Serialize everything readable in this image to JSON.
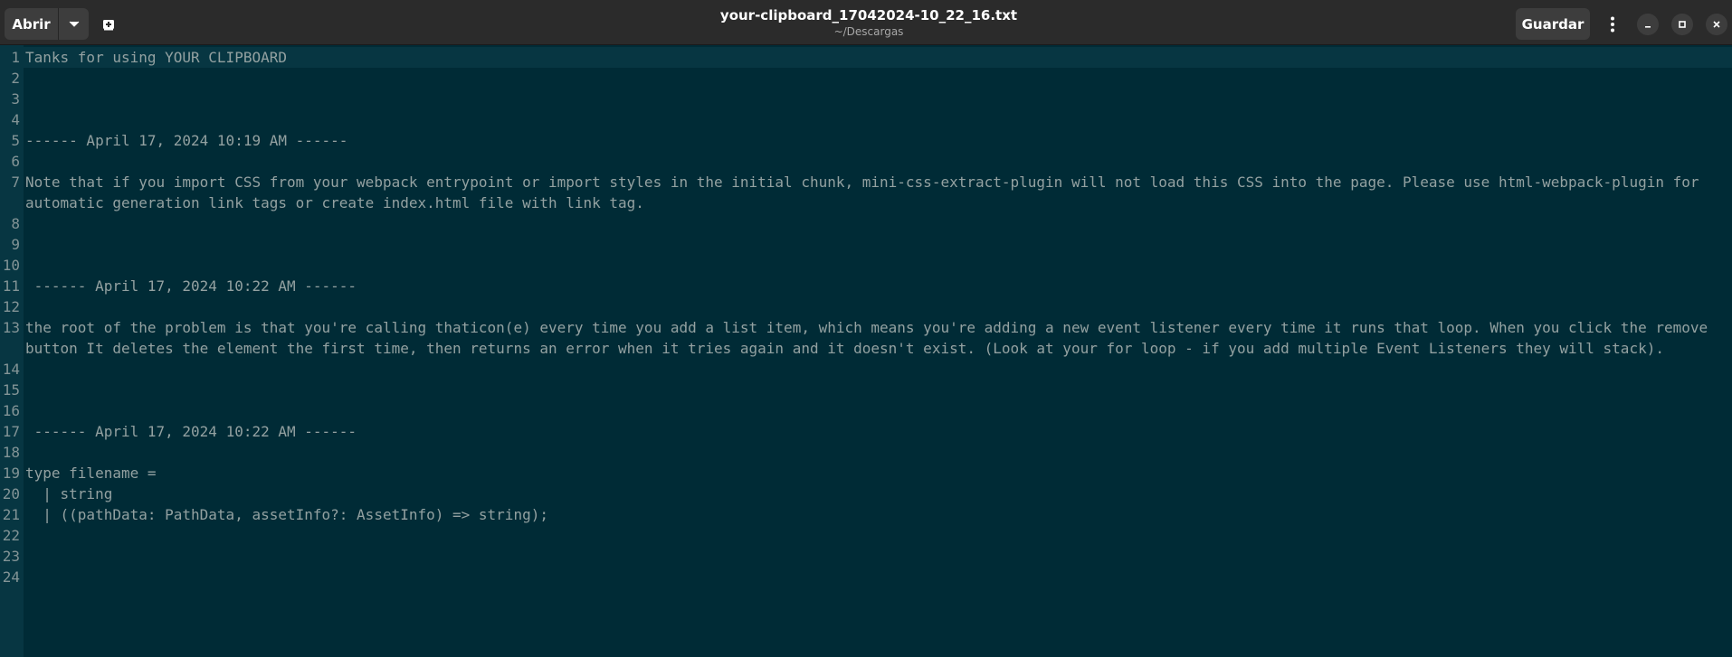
{
  "header": {
    "open_label": "Abrir",
    "title": "your-clipboard_17042024-10_22_16.txt",
    "subtitle": "~/Descargas",
    "save_label": "Guardar",
    "icons": {
      "open_dropdown": "chevron-down-icon",
      "new_document": "new-document-icon",
      "menu": "kebab-menu-icon",
      "minimize": "minimize-icon",
      "maximize": "maximize-icon",
      "close": "close-icon"
    }
  },
  "editor": {
    "colors": {
      "background": "#002b36",
      "gutter": "#073642",
      "text": "#93a1a1",
      "line_numbers": "#839496"
    },
    "lines": [
      {
        "n": "1",
        "text": "Tanks for using YOUR CLIPBOARD"
      },
      {
        "n": "2",
        "text": ""
      },
      {
        "n": "3",
        "text": ""
      },
      {
        "n": "4",
        "text": ""
      },
      {
        "n": "5",
        "text": "------ April 17, 2024 10:19 AM ------"
      },
      {
        "n": "6",
        "text": ""
      },
      {
        "n": "7",
        "text": "Note that if you import CSS from your webpack entrypoint or import styles in the initial chunk, mini-css-extract-plugin will not load this CSS into the page. Please use html-webpack-plugin for automatic generation link tags or create index.html file with link tag."
      },
      {
        "n": "8",
        "text": ""
      },
      {
        "n": "9",
        "text": ""
      },
      {
        "n": "10",
        "text": ""
      },
      {
        "n": "11",
        "text": " ------ April 17, 2024 10:22 AM ------"
      },
      {
        "n": "12",
        "text": ""
      },
      {
        "n": "13",
        "text": "the root of the problem is that you're calling thaticon(e) every time you add a list item, which means you're adding a new event listener every time it runs that loop. When you click the remove button It deletes the element the first time, then returns an error when it tries again and it doesn't exist. (Look at your for loop - if you add multiple Event Listeners they will stack)."
      },
      {
        "n": "14",
        "text": ""
      },
      {
        "n": "15",
        "text": ""
      },
      {
        "n": "16",
        "text": ""
      },
      {
        "n": "17",
        "text": " ------ April 17, 2024 10:22 AM ------"
      },
      {
        "n": "18",
        "text": ""
      },
      {
        "n": "19",
        "text": "type filename ="
      },
      {
        "n": "20",
        "text": "  | string"
      },
      {
        "n": "21",
        "text": "  | ((pathData: PathData, assetInfo?: AssetInfo) => string);"
      },
      {
        "n": "22",
        "text": ""
      },
      {
        "n": "23",
        "text": ""
      },
      {
        "n": "24",
        "text": ""
      }
    ]
  }
}
